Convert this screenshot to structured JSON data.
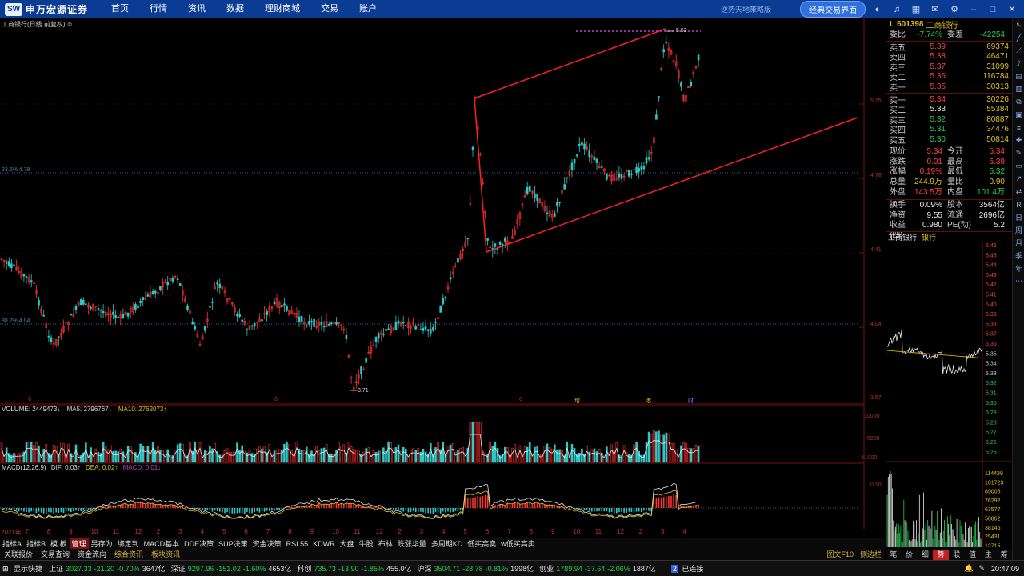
{
  "nav": {
    "logo_mark": "SW",
    "logo_name": "申万宏源证券",
    "items": [
      "首页",
      "行情",
      "资讯",
      "数据",
      "理财商城",
      "交易",
      "账户"
    ],
    "slogan": "逆势天地策略版",
    "classic_button": "经典交易界面"
  },
  "chart": {
    "title": "工商银行(日线 前复权)",
    "price_axis": [
      "5.15",
      "4.78",
      "4.41",
      "4.04",
      "3.67"
    ],
    "fib_labels": [
      "23.6% 4.79",
      "38.2% 4.04"
    ],
    "high_label": "5.52",
    "low_label": "3.71",
    "x_ticks": [
      "2021年",
      "7",
      "8",
      "9",
      "10",
      "11",
      "12",
      "2",
      "3",
      "4",
      "5",
      "6",
      "7",
      "8",
      "9",
      "10",
      "11",
      "12",
      "2",
      "3",
      "4",
      "5",
      "6",
      "7",
      "8",
      "9",
      "10",
      "11",
      "12",
      "2",
      "3",
      "4"
    ],
    "markers": [
      "6",
      "6",
      "6",
      "增",
      "港",
      "财"
    ],
    "volume_legend": {
      "vol": "VOLUME: 2449473↓",
      "ma5": "MA5: 2796767↓",
      "ma10": "MA10: 2762073↑"
    },
    "volume_axis": [
      "10000",
      "5000",
      "X1000"
    ],
    "macd_legend": {
      "title": "MACD(12,26,9)",
      "dif": "DIF: 0.03↑",
      "dea": "DEA: 0.02↑",
      "macd": "MACD: 0.01↓"
    },
    "macd_axis": [
      "0.10"
    ],
    "line_type": "日线",
    "colors": {
      "up": "#ff3030",
      "down": "#2ec8c8",
      "trendline": "#ff2020",
      "ma5": "#e8e8e8",
      "ma10": "#e0c020"
    }
  },
  "tabs": {
    "row1": [
      "指标A",
      "指标B",
      "模 板",
      "管理",
      "另存为",
      "绑定到",
      "MACD基本",
      "DDE决策",
      "SUP决策",
      "资金决策",
      "RSI 55",
      "KDWR",
      "大盘",
      "牛股",
      "布林",
      "跌涨华量",
      "多周期KD",
      "低买高卖",
      "w低买高卖"
    ],
    "row1_active": "管理",
    "row2": [
      "关联报价",
      "交易查询",
      "资金流向",
      "综合资讯",
      "板块资讯"
    ],
    "row2_right": [
      "图文F10",
      "侧边栏"
    ]
  },
  "quote": {
    "flag": "L",
    "code": "601398",
    "name": "工商银行",
    "weibi_label": "委比",
    "weibi": "-7.74%",
    "weicha_label": "委差",
    "weicha": "-42254",
    "asks": [
      {
        "label": "卖五",
        "price": "5.39",
        "vol": "69374"
      },
      {
        "label": "卖四",
        "price": "5.38",
        "vol": "46471"
      },
      {
        "label": "卖三",
        "price": "5.37",
        "vol": "31099"
      },
      {
        "label": "卖二",
        "price": "5.36",
        "vol": "116784"
      },
      {
        "label": "卖一",
        "price": "5.35",
        "vol": "30313"
      }
    ],
    "bids": [
      {
        "label": "买一",
        "price": "5.34",
        "vol": "30226"
      },
      {
        "label": "买二",
        "price": "5.33",
        "vol": "55384"
      },
      {
        "label": "买三",
        "price": "5.32",
        "vol": "80887"
      },
      {
        "label": "买四",
        "price": "5.31",
        "vol": "34476"
      },
      {
        "label": "买五",
        "price": "5.30",
        "vol": "50814"
      }
    ],
    "stats": [
      [
        "现价",
        "5.34",
        "今开",
        "5.34"
      ],
      [
        "涨跌",
        "0.01",
        "最高",
        "5.39"
      ],
      [
        "涨幅",
        "0.19%",
        "最低",
        "5.32"
      ],
      [
        "总量",
        "244.9万",
        "量比",
        "0.90"
      ],
      [
        "外盘",
        "143.5万",
        "内盘",
        "101.4万"
      ]
    ],
    "stats2": [
      [
        "换手",
        "0.09%",
        "股本",
        "3564亿"
      ],
      [
        "净资",
        "9.55",
        "流通",
        "2696亿"
      ],
      [
        "收益(四)",
        "0.980",
        "PE(动)",
        "5.2"
      ]
    ]
  },
  "mini": {
    "name": "工商银行",
    "sector": "银行",
    "price_axis": [
      "5.46",
      "5.45",
      "5.44",
      "5.43",
      "5.42",
      "5.41",
      "5.40",
      "5.39",
      "5.38",
      "5.37",
      "5.36",
      "5.35",
      "5.34",
      "5.33",
      "5.32",
      "5.31",
      "5.30",
      "5.29",
      "5.28",
      "5.27",
      "5.26",
      "5.25"
    ],
    "vol_axis": [
      "114439",
      "101723",
      "89008",
      "76292",
      "63577",
      "50862",
      "38146",
      "25431",
      "12715"
    ],
    "tabs": [
      "笔",
      "价",
      "细",
      "势",
      "联",
      "值",
      "主",
      "筹"
    ],
    "active_tab": "势"
  },
  "status": {
    "show_label": "显示快捷",
    "items": [
      {
        "name": "上证",
        "val": "3027.33",
        "chg": "-21.20",
        "pct": "-0.70%",
        "amt": "3647亿"
      },
      {
        "name": "深证",
        "val": "9297.96",
        "chg": "-151.02",
        "pct": "-1.60%",
        "amt": "4653亿"
      },
      {
        "name": "科创",
        "val": "735.73",
        "chg": "-13.90",
        "pct": "-1.85%",
        "amt": "455.0亿"
      },
      {
        "name": "沪深",
        "val": "3504.71",
        "chg": "-28.78",
        "pct": "-0.81%",
        "amt": "1998亿"
      },
      {
        "name": "创业",
        "val": "1789.94",
        "chg": "-37.64",
        "pct": "-2.06%",
        "amt": "1887亿"
      }
    ],
    "conn_num": "2",
    "conn_text": "已连接",
    "time": "20:47:09"
  }
}
